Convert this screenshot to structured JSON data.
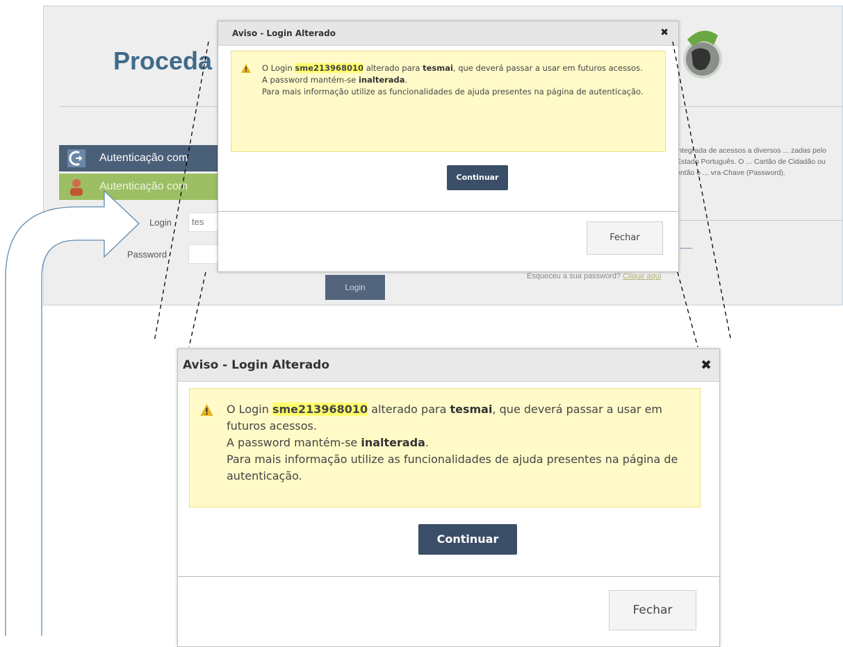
{
  "background_page": {
    "title": "Proceda",
    "auth_buttons": [
      {
        "label": "Autenticação com"
      },
      {
        "label": "Autenticação com"
      }
    ],
    "login_label": "Login",
    "login_value": "tes",
    "password_label": "Password",
    "login_button": "Login",
    "side_text": "integrada de acessos a diversos ... zadas pelo Estado Português. O ... Cartão de Cidadão ou então o ... vra-Chave (Password).",
    "forgot_text": "Esqueceu a sua password?",
    "forgot_link": "Clique aqui"
  },
  "dialog": {
    "title": "Aviso - Login Alterado",
    "close_glyph": "✖",
    "message": {
      "part1": "O Login ",
      "old_login": "sme213968010",
      "part2": " alterado para ",
      "new_login": "tesmai",
      "part3": ", que deverá passar a usar em futuros acessos.",
      "line2_prefix": "A password mantém-se ",
      "line2_bold": "inalterada",
      "line2_suffix": ".",
      "line3": "Para mais informação utilize as funcionalidades de ajuda presentes na página de autenticação."
    },
    "continue_label": "Continuar",
    "close_label": "Fechar"
  },
  "colors": {
    "header_bg": "#e6e6e6",
    "message_bg": "#fffac8",
    "highlight": "#ffff6b",
    "continue_bg": "#3b4e67",
    "title_blue": "#3f6b8a"
  }
}
